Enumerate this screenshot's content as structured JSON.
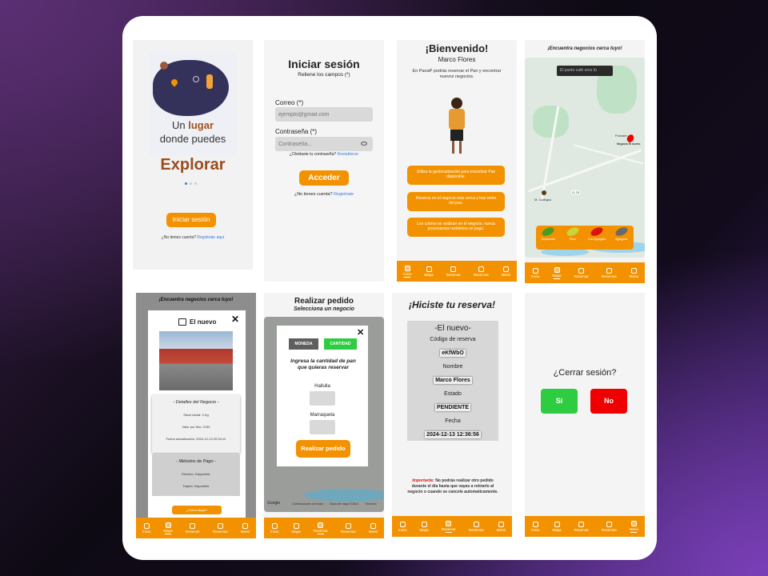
{
  "s1": {
    "title_un": "Un ",
    "title_lugar": "lugar",
    "title_donde": "donde puedes",
    "explorar": "Explorar",
    "login_btn": "Iniciar sesión",
    "no_account": "¿No tienes cuenta?",
    "register": "Registrate aquí"
  },
  "s2": {
    "title": "Iniciar sesión",
    "subtitle": "Rellene los campos (*)",
    "email_label": "Correo (*)",
    "email_placeholder": "ejemplo@gmail.com",
    "pass_label": "Contraseña (*)",
    "pass_placeholder": "Contraseña...",
    "forgot": "¿Olvidaste tu contraseña?",
    "restore": "Restablecer",
    "submit": "Acceder",
    "no_account": "¿No tienes cuenta?",
    "register": "Registrate"
  },
  "s3": {
    "title": "¡Bienvenido!",
    "name": "Marco Flores",
    "desc": "En PanaP podrás reservar el Pan y encontrar nuevos negocios.",
    "b1": "Utiliza la geolocalización para encontrar Pan disponible.",
    "b2": "Reserva en el negocio más cerca y haz retiro del pan.",
    "b3": "Los cobros se realizan en el negocio, nunca procesamos recibimos un pago."
  },
  "s4": {
    "header": "¡Encuentra negocios cerca tuyo!",
    "search": "El punto café eres tú",
    "place1": "Pomaire",
    "place2": "Negocio El nuevo",
    "place3": "M. Gallegos",
    "road": "G-78",
    "bread": [
      "Empanada",
      "Pavo",
      "Con Agregado",
      "Agregado"
    ]
  },
  "s5": {
    "header": "¡Encuentra negocios cerca tuyo!",
    "name": "El nuevo",
    "det_title": "- Detalles del Negocio -",
    "stock": "Stock inicial: 3 Kg",
    "price": "Valor por Kilo: 2150",
    "updated": "Fecha actualización: 2024-12-13 20:34:12",
    "pay_title": "- Métodos de Pago -",
    "cash": "Efectivo: Disponible",
    "card": "Tarjeta: Disponible",
    "how": "¿Cómo llegar?"
  },
  "s6": {
    "title": "Realizar pedido",
    "subtitle": "Selecciona un negocio",
    "tab1": "MONEDA",
    "tab2": "CANTIDAD",
    "prompt": "Ingresa la cantidad de pan que quieras reservar",
    "f1": "Hallulla",
    "f2": "Marraqueta",
    "submit": "Realizar pedido",
    "attr1": "Google",
    "attr2": "Combinaciones de teclas",
    "attr3": "Datos del mapa ©2024",
    "attr4": "Términos"
  },
  "s7": {
    "title": "¡Hiciste tu reserva!",
    "biz": "-El nuevo-",
    "code_label": "Código de reserva",
    "code": "eKfWbO",
    "name_label": "Nombre",
    "name": "Marco Flores",
    "state_label": "Estado",
    "state": "PENDIENTE",
    "date_label": "Fecha",
    "date": "2024-12-13 12:36:56",
    "imp_label": "Importante:",
    "imp_text": "No podrás realizar otro pedido durante el día hasta que vayas a retirarlo al negocio o cuando se cancele automaticamente."
  },
  "s8": {
    "question": "¿Cerrar sesión?",
    "yes": "Sí",
    "no": "No"
  },
  "nav": [
    "Inicio",
    "Mapa",
    "Reservar",
    "Reservas",
    "Menú"
  ],
  "colors": {
    "accent": "#f39200",
    "green": "#2ecc40",
    "red": "#ee0000"
  }
}
